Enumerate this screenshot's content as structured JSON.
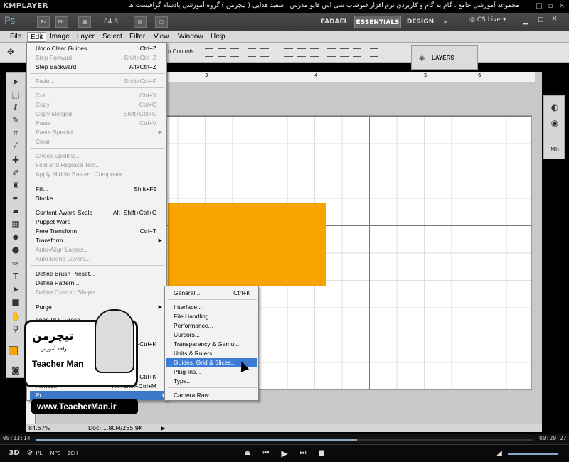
{
  "player": {
    "logo": "KMPLAYER",
    "title": "مجموعه آموزشی جامع . گام به گام و کاربردی نرم افزار فتوشاپ سی اس فایو مدرس : سعید هدایی ( تیچرمن ) گروه آموزشی پادشاه گرافیست ها",
    "time_elapsed": "00:13:14",
    "time_total": "00:20:27",
    "buttons": [
      "3D",
      "PL",
      "MP3",
      "2CH"
    ]
  },
  "ps": {
    "logo": "Ps",
    "app_bar": {
      "br_label": "Br",
      "mb_label": "Mb",
      "zoom": "84.6",
      "workspaces": [
        "FADAEI",
        "ESSENTIALS",
        "DESIGN"
      ],
      "active_workspace": "ESSENTIALS",
      "cs_live": "CS Live"
    },
    "menubar": [
      "File",
      "Edit",
      "Image",
      "Layer",
      "Select",
      "Filter",
      "View",
      "Window",
      "Help"
    ],
    "options_text": "n Controls",
    "layers_panel_label": "LAYERS",
    "ruler_marks": [
      "3",
      "4",
      "5",
      "6"
    ],
    "status": {
      "zoom": "84.57%",
      "doc": "Doc: 1.80M/255.9K"
    },
    "accent_color": "#f8a300",
    "highlight_color": "#3b7cd6"
  },
  "edit_menu": {
    "items": [
      {
        "label": "Undo Clear Guides",
        "shortcut": "Ctrl+Z",
        "disabled": false
      },
      {
        "label": "Step Forward",
        "shortcut": "Shift+Ctrl+Z",
        "disabled": true
      },
      {
        "label": "Step Backward",
        "shortcut": "Alt+Ctrl+Z",
        "disabled": false
      },
      {
        "label": "Fade...",
        "shortcut": "Shift+Ctrl+F",
        "disabled": true
      },
      {
        "label": "Cut",
        "shortcut": "Ctrl+X",
        "disabled": true
      },
      {
        "label": "Copy",
        "shortcut": "Ctrl+C",
        "disabled": true
      },
      {
        "label": "Copy Merged",
        "shortcut": "Shift+Ctrl+C",
        "disabled": true
      },
      {
        "label": "Paste",
        "shortcut": "Ctrl+V",
        "disabled": true
      },
      {
        "label": "Paste Special",
        "shortcut": "",
        "disabled": true,
        "submenu": true
      },
      {
        "label": "Clear",
        "shortcut": "",
        "disabled": true
      },
      {
        "label": "Check Spelling...",
        "shortcut": "",
        "disabled": true
      },
      {
        "label": "Find and Replace Text...",
        "shortcut": "",
        "disabled": true
      },
      {
        "label": "Apply Middle Eastern Composer...",
        "shortcut": "",
        "disabled": true
      },
      {
        "label": "Fill...",
        "shortcut": "Shift+F5",
        "disabled": false
      },
      {
        "label": "Stroke...",
        "shortcut": "",
        "disabled": false
      },
      {
        "label": "Content-Aware Scale",
        "shortcut": "Alt+Shift+Ctrl+C",
        "disabled": false
      },
      {
        "label": "Puppet Warp",
        "shortcut": "",
        "disabled": false
      },
      {
        "label": "Free Transform",
        "shortcut": "Ctrl+T",
        "disabled": false
      },
      {
        "label": "Transform",
        "shortcut": "",
        "disabled": false,
        "submenu": true
      },
      {
        "label": "Auto-Align Layers...",
        "shortcut": "",
        "disabled": true
      },
      {
        "label": "Auto-Blend Layers...",
        "shortcut": "",
        "disabled": true
      },
      {
        "label": "Define Brush Preset...",
        "shortcut": "",
        "disabled": false
      },
      {
        "label": "Define Pattern...",
        "shortcut": "",
        "disabled": false
      },
      {
        "label": "Define Custom Shape...",
        "shortcut": "",
        "disabled": true
      },
      {
        "label": "Purge",
        "shortcut": "",
        "disabled": false,
        "submenu": true
      },
      {
        "label": "dobe PDF Prese",
        "shortcut": "",
        "disabled": false
      },
      {
        "label": "",
        "shortcut": "+Ctrl+K",
        "disabled": false
      },
      {
        "label": "",
        "shortcut": "+Ctrl+K",
        "disabled": false
      },
      {
        "label": "Menus...",
        "shortcut": "Alt+Shift+Ctrl+M",
        "disabled": false
      },
      {
        "label": "Pr",
        "shortcut": "",
        "disabled": false,
        "submenu": true
      }
    ]
  },
  "prefs_submenu": {
    "items": [
      {
        "label": "General...",
        "shortcut": "Ctrl+K"
      },
      {
        "label": "Interface...",
        "shortcut": ""
      },
      {
        "label": "File Handling...",
        "shortcut": ""
      },
      {
        "label": "Performance...",
        "shortcut": ""
      },
      {
        "label": "Cursors...",
        "shortcut": ""
      },
      {
        "label": "Transparency & Gamut...",
        "shortcut": ""
      },
      {
        "label": "Units & Rulers...",
        "shortcut": ""
      },
      {
        "label": "Guides, Grid & Slices...",
        "shortcut": ""
      },
      {
        "label": "Plug-Ins...",
        "shortcut": ""
      },
      {
        "label": "Type...",
        "shortcut": ""
      },
      {
        "label": "Camera Raw...",
        "shortcut": ""
      }
    ]
  },
  "watermark": {
    "brand_fa": "تیچرمن",
    "sub_fa": "واحد آموزش",
    "brand_en": "Teacher Man",
    "url": "www.TeacherMan.ir"
  }
}
